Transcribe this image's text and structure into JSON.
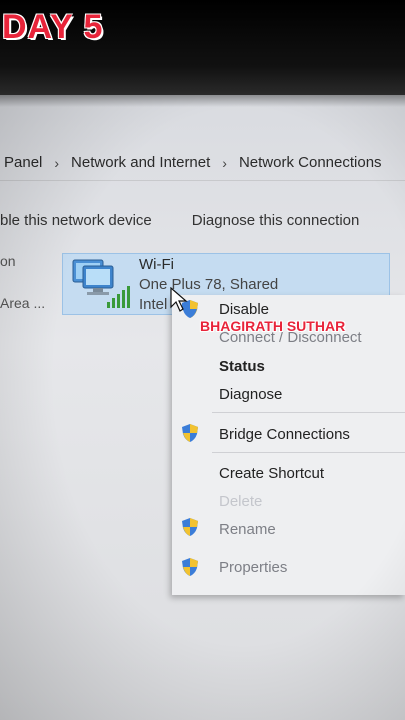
{
  "overlay": {
    "day_title": "DAY 5",
    "watermark": "BHAGIRATH SUTHAR"
  },
  "breadcrumb": {
    "items": [
      "Panel",
      "Network and Internet",
      "Network Connections"
    ]
  },
  "toolbar": {
    "disable_label": "ble this network device",
    "diagnose_label": "Diagnose this connection"
  },
  "left_column": {
    "line1": "on",
    "line2": "Area ..."
  },
  "connection": {
    "name": "Wi-Fi",
    "network": "One Plus  78, Shared",
    "adapter": "Intel"
  },
  "context_menu": {
    "items": [
      {
        "label": "Disable",
        "shield": true
      },
      {
        "label": "Connect / Disconnect",
        "shield": false
      },
      {
        "label": "Status",
        "shield": false,
        "bold": true
      },
      {
        "label": "Diagnose",
        "shield": false
      },
      {
        "label": "Bridge Connections",
        "shield": true
      },
      {
        "label": "Create Shortcut",
        "shield": false
      },
      {
        "label": "Delete",
        "shield": false,
        "disabled": true
      },
      {
        "label": "Rename",
        "shield": true
      },
      {
        "label": "Properties",
        "shield": true
      }
    ]
  },
  "colors": {
    "accent_red": "#e8243a",
    "selection_blue": "#c5dcf1",
    "menu_bg": "#eeeff1"
  },
  "icons": [
    "shield-icon",
    "network-adapter-icon",
    "cursor-icon",
    "chevron-right-icon"
  ]
}
